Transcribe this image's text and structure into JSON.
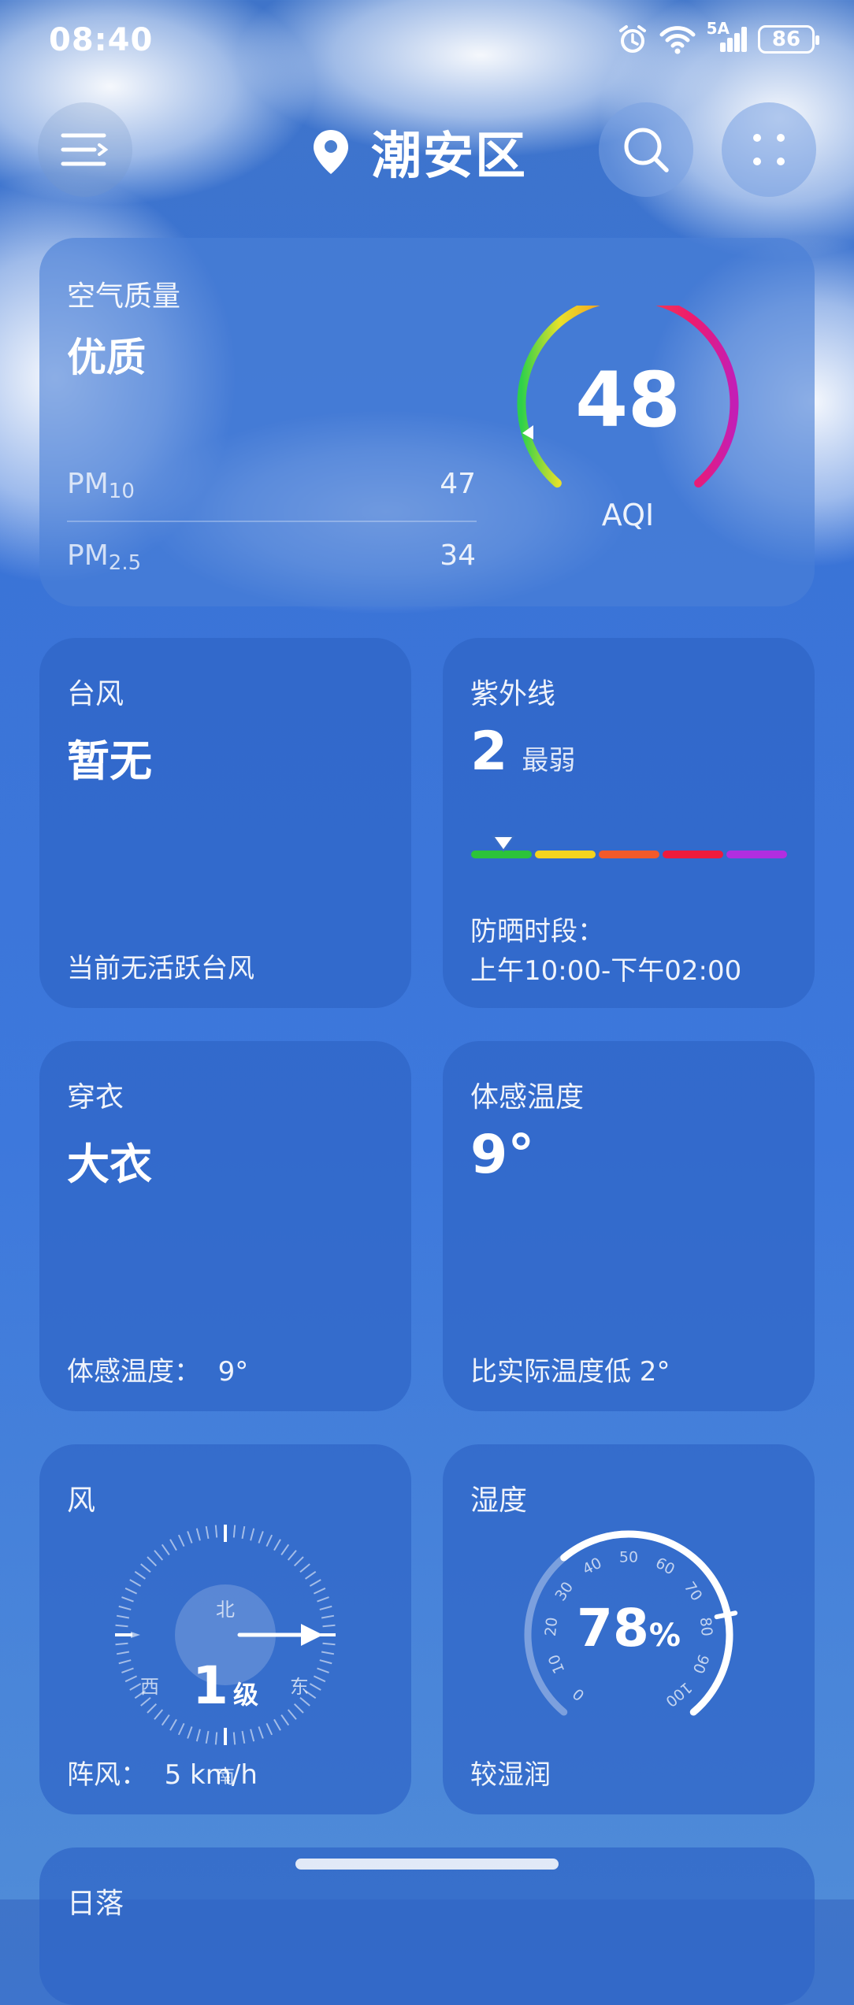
{
  "status_bar": {
    "time": "08:40",
    "network": "5A",
    "battery": "86",
    "icons": [
      "alarm-icon",
      "wifi-icon",
      "signal-icon"
    ]
  },
  "header": {
    "location": "潮安区",
    "icons": [
      "menu-icon",
      "location-pin-icon",
      "search-icon",
      "grid-icon"
    ]
  },
  "air_quality": {
    "title": "空气质量",
    "level": "优质",
    "aqi": "48",
    "aqi_label": "AQI",
    "aqi_value": 48,
    "pm10_label": "PM",
    "pm10_sub": "10",
    "pm10_value": "47",
    "pm25_label": "PM",
    "pm25_sub": "2.5",
    "pm25_value": "34"
  },
  "typhoon": {
    "title": "台风",
    "value": "暂无",
    "note": "当前无活跃台风"
  },
  "uv": {
    "title": "紫外线",
    "value": "2",
    "level": "最弱",
    "sun_label": "防晒时段：",
    "sun_time": "上午10:00-下午02:00",
    "colors": [
      "#2cc33a",
      "#f4d41e",
      "#f25a2a",
      "#ee1b3c",
      "#b12ee0"
    ]
  },
  "clothing": {
    "title": "穿衣",
    "value": "大衣",
    "note": "体感温度：  9°"
  },
  "feels_like": {
    "title": "体感温度",
    "value": "9°",
    "note": "比实际温度低 2°"
  },
  "wind": {
    "title": "风",
    "level_num": "1",
    "level_unit": "级",
    "north": "北",
    "south": "南",
    "west": "西",
    "east": "东",
    "gust": "阵风：  5 km/h"
  },
  "humidity": {
    "title": "湿度",
    "value": "78",
    "unit": "%",
    "note": "较湿润",
    "percent": 78,
    "ticks": [
      "0",
      "10",
      "20",
      "30",
      "40",
      "50",
      "60",
      "70",
      "80",
      "90",
      "100"
    ]
  },
  "sunset": {
    "title": "日落"
  }
}
